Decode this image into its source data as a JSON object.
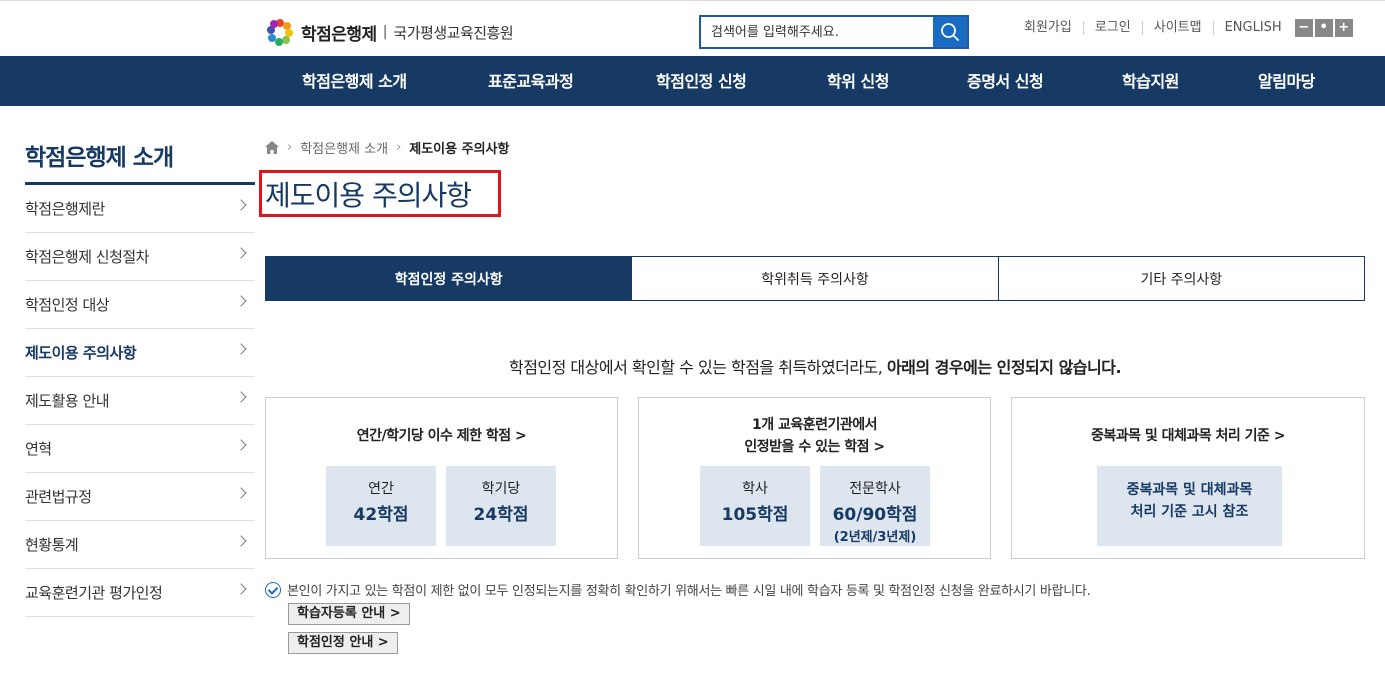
{
  "header": {
    "logo_title": "학점은행제",
    "logo_sep": "|",
    "logo_org": "국가평생교육진흥원",
    "search_placeholder": "검색어를 입력해주세요.",
    "util": [
      "회원가입",
      "로그인",
      "사이트맵",
      "ENGLISH"
    ],
    "zoom": [
      "−",
      "•",
      "+"
    ]
  },
  "gnb": [
    "학점은행제 소개",
    "표준교육과정",
    "학점인정 신청",
    "학위 신청",
    "증명서 신청",
    "학습지원",
    "알림마당"
  ],
  "lnb": {
    "title": "학점은행제 소개",
    "items": [
      "학점은행제란",
      "학점은행제 신청절차",
      "학점인정 대상",
      "제도이용 주의사항",
      "제도활용 안내",
      "연혁",
      "관련법규정",
      "현황통계",
      "교육훈련기관 평가인정"
    ],
    "active_index": 3
  },
  "breadcrumb": {
    "parent": "학점은행제 소개",
    "current": "제도이용 주의사항"
  },
  "page_title": "제도이용 주의사항",
  "tabs": [
    "학점인정 주의사항",
    "학위취득 주의사항",
    "기타 주의사항"
  ],
  "intro": {
    "normal": "학점인정 대상에서 확인할 수 있는 학점을 취득하였더라도, ",
    "bold": "아래의 경우에는 인정되지 않습니다."
  },
  "cards": [
    {
      "title": "연간/학기당 이수 제한 학점 >",
      "boxes": [
        {
          "l1": "연간",
          "l2": "42학점"
        },
        {
          "l1": "학기당",
          "l2": "24학점"
        }
      ]
    },
    {
      "title_line1": "1개 교육훈련기관에서",
      "title_line2": "인정받을 수 있는 학점 >",
      "boxes": [
        {
          "l1": "학사",
          "l2": "105학점"
        },
        {
          "l1": "전문학사",
          "l2": "60/90학점",
          "l3": "(2년제/3년제)"
        }
      ]
    },
    {
      "title": "중복과목 및 대체과목 처리 기준 >",
      "box_line1": "중복과목 및 대체과목",
      "box_line2": "처리 기준 고시 참조"
    }
  ],
  "note": "본인이 가지고 있는 학점이 제한 없이 모두 인정되는지를 정확히 확인하기 위해서는 빠른 시일 내에 학습자 등록 및 학점인정 신청을 완료하시기 바랍니다.",
  "buttons": [
    "학습자등록 안내 >",
    "학점인정 안내 >"
  ]
}
